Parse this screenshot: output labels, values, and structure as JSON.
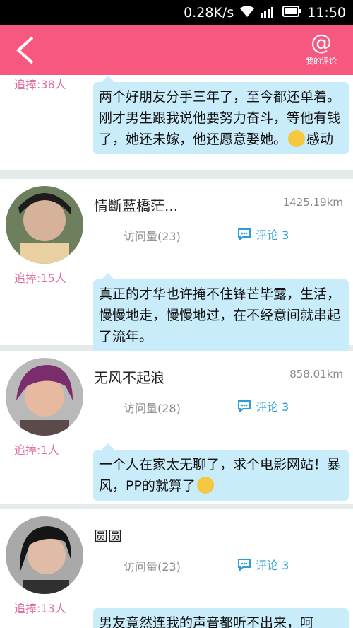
{
  "status": {
    "speed": "0.28K/s",
    "time": "11:50"
  },
  "appbar": {
    "my_comments_label": "我的评论"
  },
  "posts": [
    {
      "fans": "追捧:38人",
      "text": "两个好朋友分手三年了，至今都还单着。刚才男生跟我说他要努力奋斗，等他有钱了，她还未嫁，他还愿意娶她。",
      "after_emoji": "感动"
    },
    {
      "name": "情斷藍橋茫...",
      "distance": "1425.19km",
      "visits": "访问量(23)",
      "comments": "评论 3",
      "fans": "追捧:15人",
      "text": "真正的才华也许掩不住锋芒毕露，生活，慢慢地走，慢慢地过，在不经意间就串起了流年。"
    },
    {
      "name": "无风不起浪",
      "distance": "858.01km",
      "visits": "访问量(28)",
      "comments": "评论 3",
      "fans": "追捧:1人",
      "text": "一个人在家太无聊了，求个电影网站！暴风，PP的就算了"
    },
    {
      "name": "圆圆",
      "visits": "访问量(23)",
      "comments": "评论 3",
      "fans": "追捧:13人",
      "text": "男友竟然连我的声音都听不出来，呵"
    }
  ],
  "colors": {
    "accent": "#f6587f",
    "bubble": "#c9ecfb",
    "link": "#2a9fd6",
    "fans": "#e06ea0"
  }
}
